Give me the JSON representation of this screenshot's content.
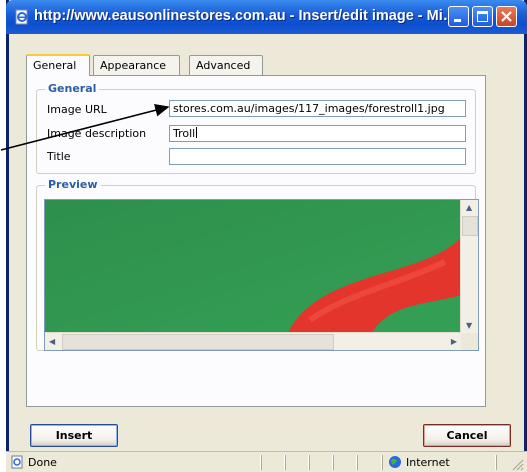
{
  "window": {
    "title": "http://www.eausonlinestores.com.au - Insert/edit image - Mi…",
    "controls": {
      "minimize": "minimize-icon",
      "maximize": "maximize-icon",
      "close": "close-icon"
    }
  },
  "tabs": [
    {
      "label": "General",
      "active": true
    },
    {
      "label": "Appearance",
      "active": false
    },
    {
      "label": "Advanced",
      "active": false
    }
  ],
  "general": {
    "legend": "General",
    "fields": {
      "image_url": {
        "label": "Image URL",
        "value": "stores.com.au/images/117_images/forestroll1.jpg"
      },
      "image_description": {
        "label": "Image description",
        "value": "Troll"
      },
      "title": {
        "label": "Title",
        "value": ""
      }
    }
  },
  "preview": {
    "legend": "Preview",
    "image": "troll-photo",
    "colors": {
      "background": "#2f9550",
      "subject": "#e8362c"
    }
  },
  "buttons": {
    "insert": "Insert",
    "cancel": "Cancel"
  },
  "statusbar": {
    "status": "Done",
    "zone": "Internet"
  },
  "annotation": {
    "type": "arrow",
    "target": "image-url-field"
  }
}
